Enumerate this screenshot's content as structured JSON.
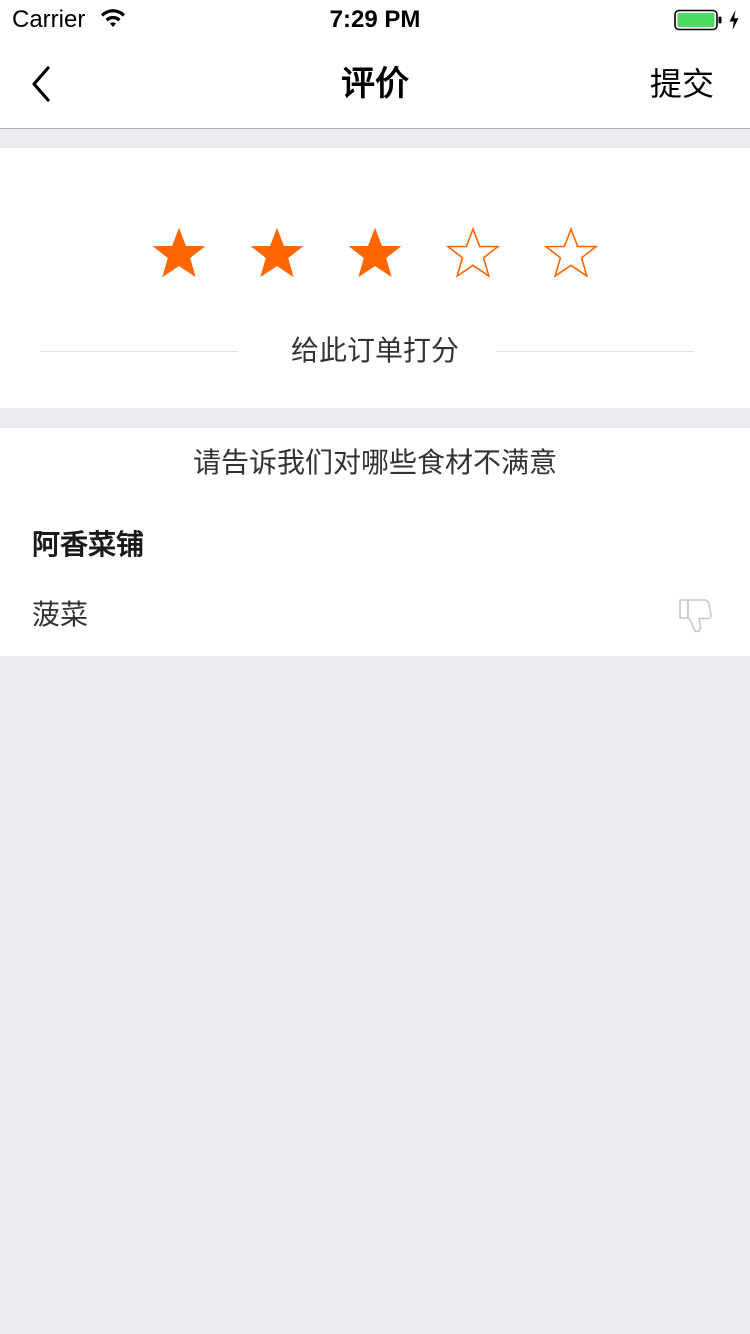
{
  "status_bar": {
    "carrier": "Carrier",
    "time": "7:29 PM",
    "wifi_icon": "wifi-icon",
    "battery_icon": "battery-icon",
    "charging_icon": "charging-bolt-icon",
    "battery_color": "#4cd964"
  },
  "nav": {
    "back_icon": "chevron-left-icon",
    "title": "评价",
    "submit_label": "提交"
  },
  "rating": {
    "value": 3,
    "max": 5,
    "star_color": "#ff6600",
    "caption": "给此订单打分"
  },
  "feedback": {
    "prompt": "请告诉我们对哪些食材不满意",
    "shop_name": "阿香菜铺",
    "items": [
      {
        "name": "菠菜",
        "icon": "thumbs-down-icon",
        "selected": false
      }
    ]
  }
}
